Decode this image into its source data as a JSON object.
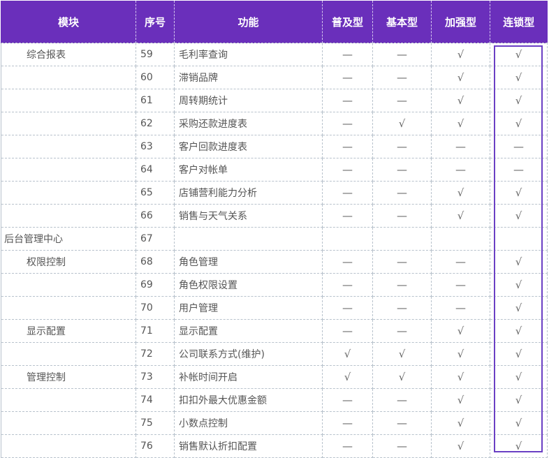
{
  "header": [
    "模块",
    "序号",
    "功能",
    "普及型",
    "基本型",
    "加强型",
    "连锁型"
  ],
  "rows": [
    {
      "module": "综合报表",
      "indent": 2,
      "num": "59",
      "func": "毛利率查询",
      "marks": [
        "—",
        "—",
        "√",
        "√"
      ]
    },
    {
      "module": "",
      "indent": 2,
      "num": "60",
      "func": "滞销品牌",
      "marks": [
        "—",
        "—",
        "√",
        "√"
      ]
    },
    {
      "module": "",
      "indent": 2,
      "num": "61",
      "func": "周转期统计",
      "marks": [
        "—",
        "—",
        "√",
        "√"
      ]
    },
    {
      "module": "",
      "indent": 2,
      "num": "62",
      "func": "采购还款进度表",
      "marks": [
        "—",
        "√",
        "√",
        "√"
      ]
    },
    {
      "module": "",
      "indent": 2,
      "num": "63",
      "func": "客户回款进度表",
      "marks": [
        "—",
        "—",
        "—",
        "—"
      ]
    },
    {
      "module": "",
      "indent": 2,
      "num": "64",
      "func": "客户对帐单",
      "marks": [
        "—",
        "—",
        "—",
        "—"
      ]
    },
    {
      "module": "",
      "indent": 2,
      "num": "65",
      "func": "店铺营利能力分析",
      "marks": [
        "—",
        "—",
        "√",
        "√"
      ]
    },
    {
      "module": "",
      "indent": 2,
      "num": "66",
      "func": "销售与天气关系",
      "marks": [
        "—",
        "—",
        "√",
        "√"
      ]
    },
    {
      "module": "后台管理中心",
      "indent": 0,
      "num": "67",
      "func": "",
      "marks": [
        "",
        "",
        "",
        ""
      ]
    },
    {
      "module": "权限控制",
      "indent": 2,
      "num": "68",
      "func": "角色管理",
      "marks": [
        "—",
        "—",
        "—",
        "√"
      ]
    },
    {
      "module": "",
      "indent": 2,
      "num": "69",
      "func": "角色权限设置",
      "marks": [
        "—",
        "—",
        "—",
        "√"
      ]
    },
    {
      "module": "",
      "indent": 2,
      "num": "70",
      "func": "用户管理",
      "marks": [
        "—",
        "—",
        "—",
        "√"
      ]
    },
    {
      "module": "显示配置",
      "indent": 2,
      "num": "71",
      "func": "显示配置",
      "marks": [
        "—",
        "—",
        "√",
        "√"
      ]
    },
    {
      "module": "",
      "indent": 2,
      "num": "72",
      "func": "公司联系方式(维护)",
      "marks": [
        "√",
        "√",
        "√",
        "√"
      ]
    },
    {
      "module": "管理控制",
      "indent": 2,
      "num": "73",
      "func": "补帐时间开启",
      "marks": [
        "√",
        "√",
        "√",
        "√"
      ]
    },
    {
      "module": "",
      "indent": 2,
      "num": "74",
      "func": "扣扣外最大优惠金额",
      "marks": [
        "—",
        "—",
        "√",
        "√"
      ]
    },
    {
      "module": "",
      "indent": 2,
      "num": "75",
      "func": "小数点控制",
      "marks": [
        "—",
        "—",
        "√",
        "√"
      ]
    },
    {
      "module": "",
      "indent": 2,
      "num": "76",
      "func": "销售默认折扣配置",
      "marks": [
        "—",
        "—",
        "√",
        "√"
      ]
    }
  ]
}
